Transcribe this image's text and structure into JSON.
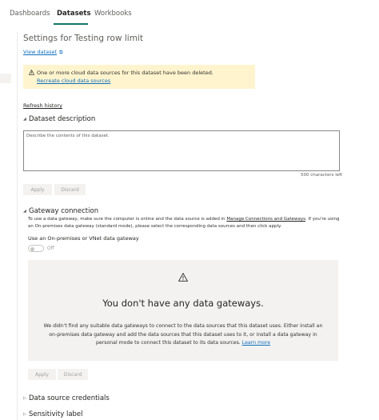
{
  "tabs": [
    {
      "label": "Dashboards"
    },
    {
      "label": "Datasets"
    },
    {
      "label": "Workbooks"
    }
  ],
  "page": {
    "title": "Settings for Testing row limit",
    "view_dataset": "View dataset"
  },
  "warning": {
    "message": "One or more cloud data sources for this dataset have been deleted.",
    "link": "Recreate cloud data sources"
  },
  "refresh_history": "Refresh history",
  "description": {
    "heading": "Dataset description",
    "placeholder": "Describe the contents of this dataset.",
    "char_count": "500 characters left",
    "apply": "Apply",
    "discard": "Discard"
  },
  "gateway": {
    "heading": "Gateway connection",
    "desc_part1": "To use a data gateway, make sure the computer is online and the data source is added in ",
    "desc_link": "Manage Connections and Gateways",
    "desc_part2": ". If you're using an On-premises data gateway (standard mode), please select the corresponding data sources and then click apply.",
    "toggle_label": "Use an On-premises or VNet data gateway",
    "toggle_state": "Off",
    "empty_title": "You don't have any data gateways.",
    "empty_body": "We didn't find any suitable data gateways to connect to the data sources that this dataset uses. Either install an on-premises data gateway and add the data sources that this dataset uses to it, or install a data gateway in personal mode to connect this dataset to its data sources.",
    "learn_more": "Learn more",
    "apply": "Apply",
    "discard": "Discard"
  },
  "sections": {
    "credentials": "Data source credentials",
    "sensitivity": "Sensitivity label"
  },
  "colors": {
    "accent": "#117865",
    "link": "#106ebe",
    "warning_bg": "#fff4ce",
    "panel_bg": "#f3f2f1"
  }
}
